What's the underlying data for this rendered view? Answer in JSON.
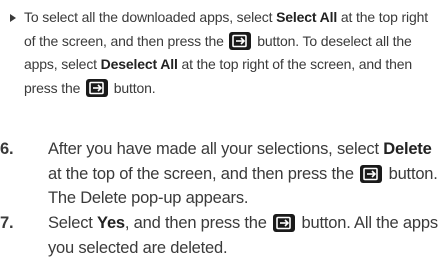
{
  "bullet": {
    "t1": "To select all the downloaded apps, select ",
    "b1": "Select All",
    "t2": " at the top right of the screen, and then press the ",
    "t3": " button. To deselect all the apps, select ",
    "b2": "Deselect All",
    "t4": " at the top right of the screen, and then press the ",
    "t5": " button."
  },
  "step6": {
    "number": "6.",
    "t1": "After you have made all your selections, select ",
    "b1": "Delete",
    "t2": " at the top of the screen, and then press the ",
    "t3": " button. The Delete pop-up appears."
  },
  "step7": {
    "number": "7.",
    "t1": "Select ",
    "b1": "Yes",
    "t2": ", and then press the ",
    "t3": " button. All the apps you selected are deleted."
  },
  "icons": {
    "enter": "enter-button-icon",
    "bullet": "triangle-bullet-icon"
  },
  "colors": {
    "text": "#3a3a3a",
    "icon_bg": "#1a1a1a"
  }
}
